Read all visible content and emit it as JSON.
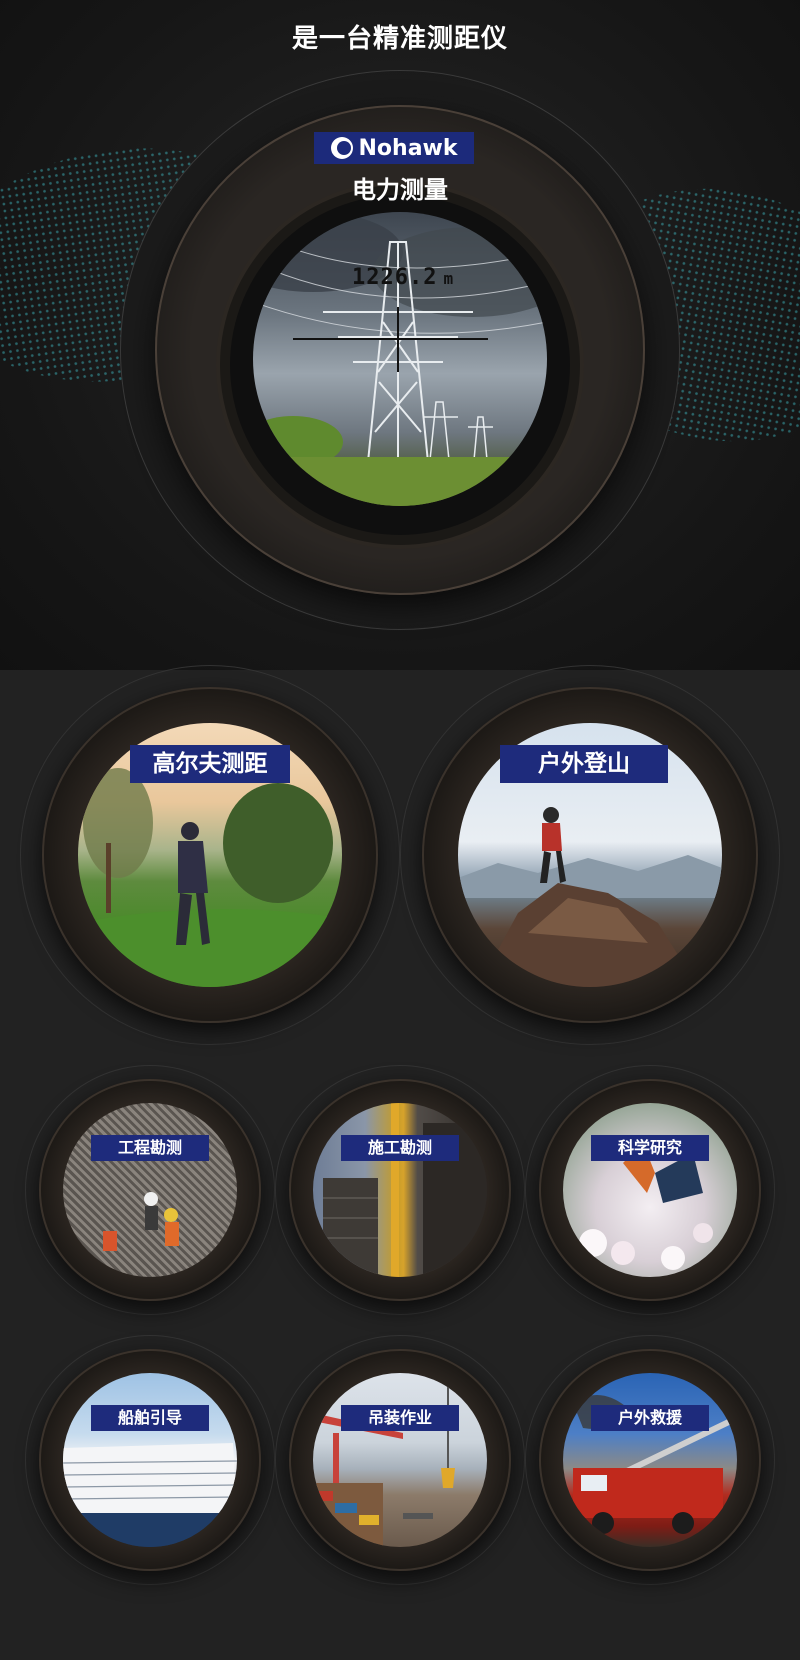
{
  "page": {
    "title": "是一台精准测距仪"
  },
  "hero": {
    "brand": "Nohawk",
    "label": "电力测量",
    "readout_value": "1226.2",
    "readout_unit": "m"
  },
  "applications_large": [
    {
      "label": "高尔夫测距"
    },
    {
      "label": "户外登山"
    }
  ],
  "applications_row1": [
    {
      "label": "工程勘测"
    },
    {
      "label": "施工勘测"
    },
    {
      "label": "科学研究"
    }
  ],
  "applications_row2": [
    {
      "label": "船舶引导"
    },
    {
      "label": "吊装作业"
    },
    {
      "label": "户外救援"
    }
  ],
  "colors": {
    "accent": "#1e2b7c",
    "top_bar": "#2c2a86",
    "wave": "#46d2dc",
    "background": "#1b1b1b"
  },
  "icons": [
    "nohawk-logo-icon"
  ]
}
